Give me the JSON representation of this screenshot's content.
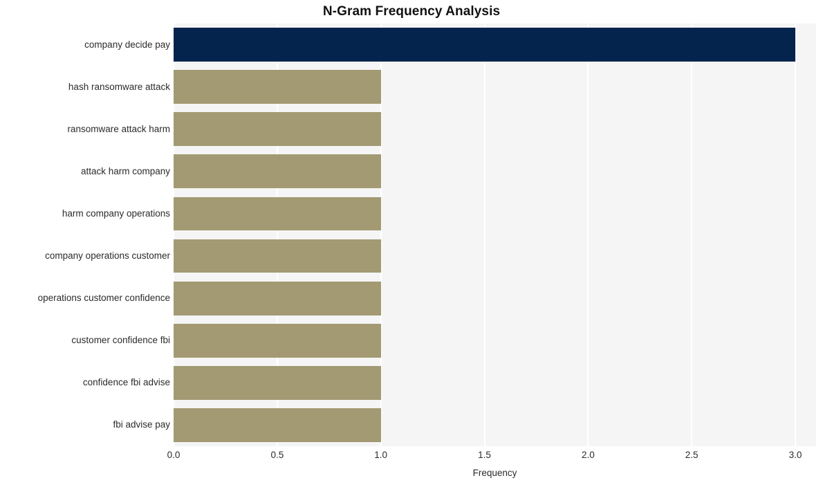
{
  "chart_data": {
    "type": "bar",
    "orientation": "horizontal",
    "title": "N-Gram Frequency Analysis",
    "xlabel": "Frequency",
    "ylabel": "",
    "categories": [
      "company decide pay",
      "hash ransomware attack",
      "ransomware attack harm",
      "attack harm company",
      "harm company operations",
      "company operations customer",
      "operations customer confidence",
      "customer confidence fbi",
      "confidence fbi advise",
      "fbi advise pay"
    ],
    "values": [
      3,
      1,
      1,
      1,
      1,
      1,
      1,
      1,
      1,
      1
    ],
    "bar_colors": [
      "#04234d",
      "#a39a73",
      "#a39a73",
      "#a39a73",
      "#a39a73",
      "#a39a73",
      "#a39a73",
      "#a39a73",
      "#a39a73",
      "#a39a73"
    ],
    "xlim": [
      0,
      3.1
    ],
    "xticks": [
      0.0,
      0.5,
      1.0,
      1.5,
      2.0,
      2.5,
      3.0
    ],
    "xtick_labels": [
      "0.0",
      "0.5",
      "1.0",
      "1.5",
      "2.0",
      "2.5",
      "3.0"
    ],
    "grid": true,
    "grid_axis": "x",
    "grid_color": "#ffffff",
    "plot_background": "#f5f5f5",
    "figure_background": "#ffffff",
    "legend": null,
    "legend_position": "none",
    "title_color": "#111111",
    "tick_label_color": "#2b2b2b"
  }
}
